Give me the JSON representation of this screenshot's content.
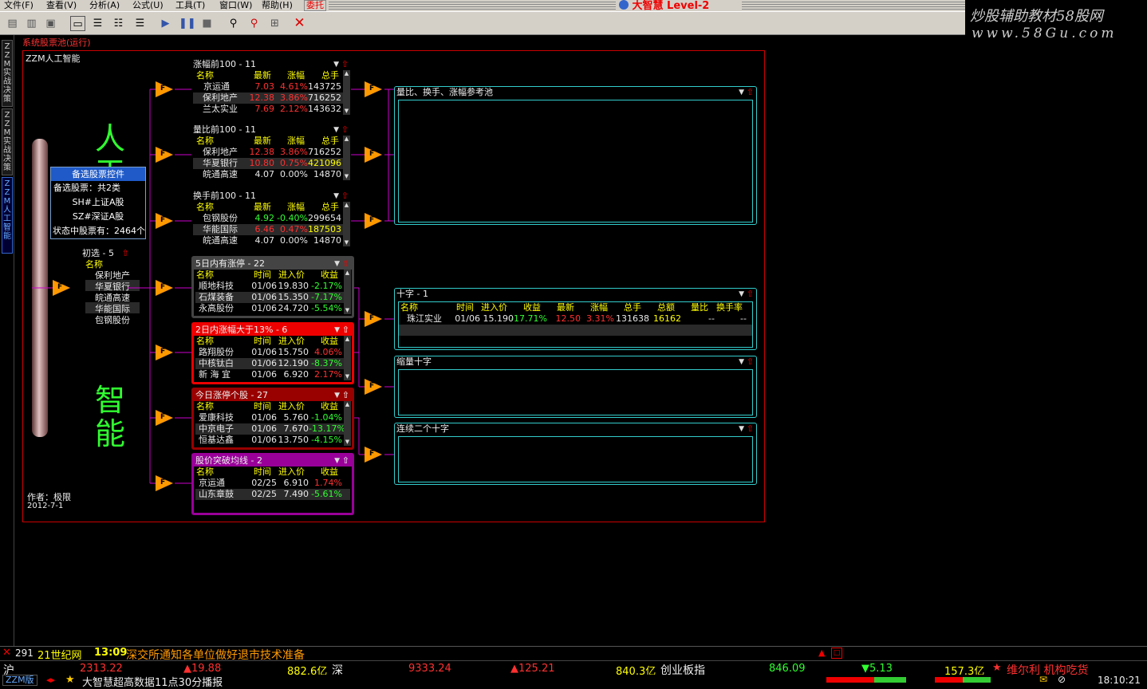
{
  "menu": [
    "文件(F)",
    "查看(V)",
    "分析(A)",
    "公式(U)",
    "工具(T)",
    "窗口(W)",
    "帮助(H)",
    "委托"
  ],
  "app_title": "大智慧 Level-2",
  "brand": {
    "line1": "炒股辅助教材58股网",
    "line2": "www.58Gu.com"
  },
  "left_tabs": [
    "ZZM实战决策",
    "ZZM实战决策",
    "ZZM人工智能"
  ],
  "window_title": "系统股票池(运行)",
  "frame_title": "ZZM人工智能",
  "big_chars": [
    "人",
    "工",
    "智",
    "能"
  ],
  "popup": {
    "title": "备选股票控件",
    "lines": [
      "备选股票：共2类",
      "SH#上证A股",
      "SZ#深证A股",
      "状态中股票有：2464个"
    ]
  },
  "first_filter": {
    "title": "初选 - 5",
    "header": "名称",
    "items": [
      "保利地产",
      "华夏银行",
      "皖通高速",
      "华能国际",
      "包钢股份"
    ]
  },
  "author": {
    "label": "作者：极限",
    "date": "2012-7-1"
  },
  "panels_a": [
    {
      "title": "涨幅前100 - 11",
      "cols": [
        "名称",
        "最新",
        "涨幅",
        "总手"
      ],
      "rows": [
        [
          "京运通",
          "7.03",
          "4.61%",
          "143725"
        ],
        [
          "保利地产",
          "12.38",
          "3.86%",
          "716252"
        ],
        [
          "兰太实业",
          "7.69",
          "2.12%",
          "143632"
        ]
      ]
    },
    {
      "title": "量比前100 - 11",
      "cols": [
        "名称",
        "最新",
        "涨幅",
        "总手"
      ],
      "rows": [
        [
          "保利地产",
          "12.38",
          "3.86%",
          "716252"
        ],
        [
          "华夏银行",
          "10.80",
          "0.75%",
          "421096"
        ],
        [
          "皖通高速",
          "4.07",
          "0.00%",
          "14870"
        ]
      ]
    },
    {
      "title": "换手前100 - 11",
      "cols": [
        "名称",
        "最新",
        "涨幅",
        "总手"
      ],
      "rows": [
        [
          "包钢股份",
          "4.92",
          "-0.40%",
          "299654"
        ],
        [
          "华能国际",
          "6.46",
          "0.47%",
          "187503"
        ],
        [
          "皖通高速",
          "4.07",
          "0.00%",
          "14870"
        ]
      ]
    }
  ],
  "panels_b": [
    {
      "title": "5日内有涨停 - 22",
      "cols": [
        "名称",
        "时间",
        "进入价",
        "收益"
      ],
      "rows": [
        [
          "顺地科技",
          "01/06",
          "19.830",
          "-2.17%"
        ],
        [
          "石煤装备",
          "01/06",
          "15.350",
          "-7.17%"
        ],
        [
          "永高股份",
          "01/06",
          "24.720",
          "-5.54%"
        ]
      ]
    },
    {
      "title": "2日内涨幅大于13% - 6",
      "cols": [
        "名称",
        "时间",
        "进入价",
        "收益"
      ],
      "rows": [
        [
          "路翔股份",
          "01/06",
          "15.750",
          "4.06%"
        ],
        [
          "中核钛白",
          "01/06",
          "12.190",
          "-8.37%"
        ],
        [
          "新 海 宜",
          "01/06",
          "6.920",
          "2.17%"
        ]
      ]
    },
    {
      "title": "今日涨停个股 - 27",
      "cols": [
        "名称",
        "时间",
        "进入价",
        "收益"
      ],
      "rows": [
        [
          "爱康科技",
          "01/06",
          "5.760",
          "-1.04%"
        ],
        [
          "中京电子",
          "01/06",
          "7.670",
          "-13.17%"
        ],
        [
          "恒基达鑫",
          "01/06",
          "13.750",
          "-4.15%"
        ]
      ]
    },
    {
      "title": "股价突破均线 - 2",
      "cols": [
        "名称",
        "时间",
        "进入价",
        "收益"
      ],
      "rows": [
        [
          "京运通",
          "02/25",
          "6.910",
          "1.74%"
        ],
        [
          "山东章鼓",
          "02/25",
          "7.490",
          "-5.61%"
        ]
      ]
    }
  ],
  "right_panels": {
    "pool": {
      "title": "量比、换手、涨幅参考池"
    },
    "cross": {
      "title": "十字 - 1",
      "cols": [
        "名称",
        "时间",
        "进入价",
        "收益",
        "最新",
        "涨幅",
        "总手",
        "总额",
        "量比",
        "换手率"
      ],
      "row": [
        "珠江实业",
        "01/06",
        "15.190",
        "-17.71%",
        "12.50",
        "3.31%",
        "131638",
        "16162",
        "--",
        "--"
      ]
    },
    "shrink": {
      "title": "缩量十字"
    },
    "two_cross": {
      "title": "连续二个十字"
    }
  },
  "ticker": {
    "count": "291",
    "source": "21世纪网",
    "time": "13:09",
    "text": "深交所通知各单位做好退市技术准备"
  },
  "index_bar": {
    "sh_label": "沪",
    "sh_value": "2313.22",
    "sh_change": "▲19.88",
    "sh_amount": "882.6亿",
    "sz_label": "深",
    "sz_value": "9333.24",
    "sz_change": "▲125.21",
    "sz_amount": "840.3亿",
    "cy_label": "创业板指",
    "cy_value": "846.09",
    "cy_change": "▼5.13",
    "cy_amount": "157.3亿",
    "news": "维尔利 机构吃货"
  },
  "status": {
    "tab": "ZZM版",
    "msg": "大智慧超高数据11点30分播报",
    "clock": "18:10:21"
  }
}
